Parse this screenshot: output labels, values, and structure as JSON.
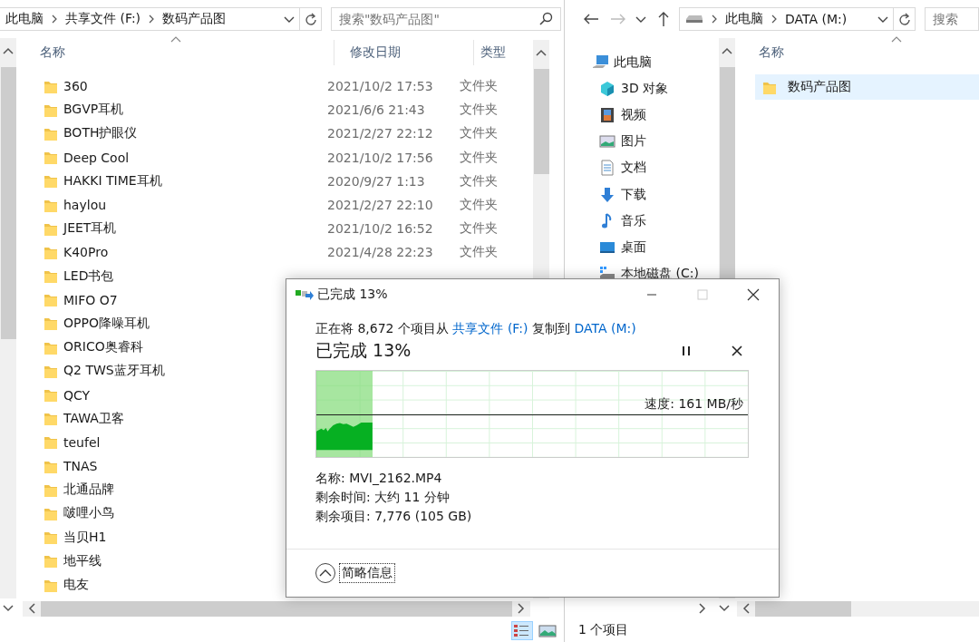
{
  "left_window": {
    "breadcrumbs": [
      "此电脑",
      "共享文件 (F:)",
      "数码产品图"
    ],
    "search": {
      "placeholder": "搜索\"数码产品图\""
    },
    "columns": [
      "名称",
      "修改日期",
      "类型"
    ],
    "rows": [
      {
        "name": "360",
        "date": "2021/10/2 17:53",
        "type": "文件夹",
        "selected": false
      },
      {
        "name": "BGVP耳机",
        "date": "2021/6/6 21:43",
        "type": "文件夹",
        "selected": false
      },
      {
        "name": "BOTH护眼仪",
        "date": "2021/2/27 22:12",
        "type": "文件夹",
        "selected": false
      },
      {
        "name": "Deep Cool",
        "date": "2021/10/2 17:56",
        "type": "文件夹",
        "selected": false
      },
      {
        "name": "HAKKI TIME耳机",
        "date": "2020/9/27 1:13",
        "type": "文件夹",
        "selected": false
      },
      {
        "name": "haylou",
        "date": "2021/2/27 22:10",
        "type": "文件夹",
        "selected": false
      },
      {
        "name": "JEET耳机",
        "date": "2021/10/2 16:52",
        "type": "文件夹",
        "selected": false
      },
      {
        "name": "K40Pro",
        "date": "2021/4/28 22:23",
        "type": "文件夹",
        "selected": false
      },
      {
        "name": "LED书包",
        "selected": false
      },
      {
        "name": "MIFO O7",
        "selected": false
      },
      {
        "name": "OPPO降噪耳机",
        "selected": false
      },
      {
        "name": "ORICO奥睿科",
        "selected": false
      },
      {
        "name": "Q2 TWS蓝牙耳机",
        "selected": false
      },
      {
        "name": "QCY",
        "selected": false
      },
      {
        "name": "TAWA卫客",
        "selected": false
      },
      {
        "name": "teufel",
        "selected": false
      },
      {
        "name": "TNAS",
        "selected": false
      },
      {
        "name": "北通品牌",
        "selected": false
      },
      {
        "name": "啵哩小鸟",
        "selected": false
      },
      {
        "name": "当贝H1",
        "selected": false
      },
      {
        "name": "地平线",
        "selected": false
      },
      {
        "name": "电友",
        "selected": false
      }
    ],
    "view_buttons": [
      {
        "selected": true
      },
      {
        "selected": false
      }
    ]
  },
  "right_window": {
    "breadcrumbs": [
      "此电脑",
      "DATA (M:)"
    ],
    "search": {
      "placeholder": "搜索"
    },
    "nav": [
      {
        "label": "此电脑",
        "children": [
          {
            "label": "3D 对象"
          },
          {
            "label": "视频"
          },
          {
            "label": "图片"
          },
          {
            "label": "文档"
          },
          {
            "label": "下载"
          },
          {
            "label": "音乐"
          },
          {
            "label": "桌面"
          },
          {
            "label": "本地磁盘 (C:)"
          }
        ]
      }
    ],
    "columns": [
      "名称"
    ],
    "rows": [
      {
        "name": "数码产品图",
        "selected": true
      }
    ],
    "status_bar": "1 个项目"
  },
  "dialog": {
    "title": "已完成 13%",
    "description": [
      {
        "kind": "text",
        "text": "正在将 8,672 个项目从 "
      },
      {
        "kind": "link",
        "text": "共享文件 (F:)"
      },
      {
        "kind": "text",
        "text": " 复制到 "
      },
      {
        "kind": "link",
        "text": "DATA (M:)"
      }
    ],
    "heading": "已完成 13%",
    "level": 0.13,
    "speed": "速度: 161 MB/秒",
    "details": [
      "名称: MVI_2162.MP4",
      "剩余时间: 大约 11 分钟",
      "剩余项目: 7,776 (105 GB)"
    ],
    "toggle": "简略信息"
  }
}
